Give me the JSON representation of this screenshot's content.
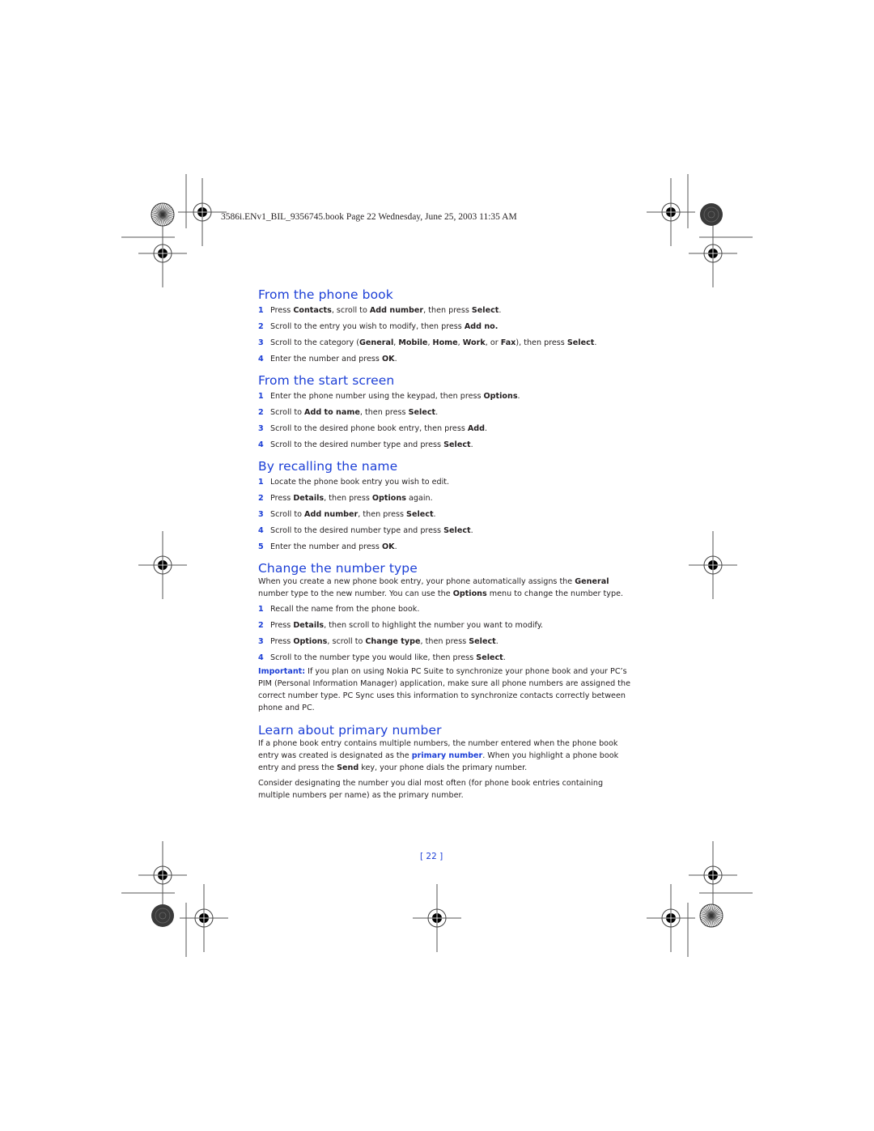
{
  "header": {
    "file_line": "3586i.ENv1_BIL_9356745.book  Page 22  Wednesday, June 25, 2003  11:35 AM"
  },
  "colors": {
    "accent": "#1c3fd6",
    "text": "#231f20"
  },
  "sections": [
    {
      "title": "From the phone book",
      "steps": [
        {
          "n": "1",
          "parts": [
            [
              "Press ",
              false
            ],
            [
              "Contacts",
              true
            ],
            [
              ", scroll to ",
              false
            ],
            [
              "Add number",
              true
            ],
            [
              ", then press ",
              false
            ],
            [
              "Select",
              true
            ],
            [
              ".",
              false
            ]
          ]
        },
        {
          "n": "2",
          "parts": [
            [
              "Scroll to the entry you wish to modify, then press ",
              false
            ],
            [
              "Add no.",
              true
            ]
          ]
        },
        {
          "n": "3",
          "parts": [
            [
              "Scroll to the category (",
              false
            ],
            [
              "General",
              true
            ],
            [
              ", ",
              false
            ],
            [
              "Mobile",
              true
            ],
            [
              ", ",
              false
            ],
            [
              "Home",
              true
            ],
            [
              ", ",
              false
            ],
            [
              "Work",
              true
            ],
            [
              ", or ",
              false
            ],
            [
              "Fax",
              true
            ],
            [
              "), then press ",
              false
            ],
            [
              "Select",
              true
            ],
            [
              ".",
              false
            ]
          ]
        },
        {
          "n": "4",
          "parts": [
            [
              "Enter the number and press ",
              false
            ],
            [
              "OK",
              true
            ],
            [
              ".",
              false
            ]
          ]
        }
      ]
    },
    {
      "title": "From the start screen",
      "steps": [
        {
          "n": "1",
          "parts": [
            [
              "Enter the phone number using the keypad, then press ",
              false
            ],
            [
              "Options",
              true
            ],
            [
              ".",
              false
            ]
          ]
        },
        {
          "n": "2",
          "parts": [
            [
              "Scroll to ",
              false
            ],
            [
              "Add to name",
              true
            ],
            [
              ", then press ",
              false
            ],
            [
              "Select",
              true
            ],
            [
              ".",
              false
            ]
          ]
        },
        {
          "n": "3",
          "parts": [
            [
              "Scroll to the desired phone book entry, then press ",
              false
            ],
            [
              "Add",
              true
            ],
            [
              ".",
              false
            ]
          ]
        },
        {
          "n": "4",
          "parts": [
            [
              "Scroll to the desired number type and press ",
              false
            ],
            [
              "Select",
              true
            ],
            [
              ".",
              false
            ]
          ]
        }
      ]
    },
    {
      "title": "By recalling the name",
      "steps": [
        {
          "n": "1",
          "parts": [
            [
              "Locate the phone book entry you wish to edit.",
              false
            ]
          ]
        },
        {
          "n": "2",
          "parts": [
            [
              "Press ",
              false
            ],
            [
              "Details",
              true
            ],
            [
              ", then press ",
              false
            ],
            [
              "Options",
              true
            ],
            [
              " again.",
              false
            ]
          ]
        },
        {
          "n": "3",
          "parts": [
            [
              "Scroll to ",
              false
            ],
            [
              "Add number",
              true
            ],
            [
              ", then press ",
              false
            ],
            [
              "Select",
              true
            ],
            [
              ".",
              false
            ]
          ]
        },
        {
          "n": "4",
          "parts": [
            [
              "Scroll to the desired number type and press ",
              false
            ],
            [
              "Select",
              true
            ],
            [
              ".",
              false
            ]
          ]
        },
        {
          "n": "5",
          "parts": [
            [
              "Enter the number and press ",
              false
            ],
            [
              "OK",
              true
            ],
            [
              ".",
              false
            ]
          ]
        }
      ]
    },
    {
      "title": "Change the number type",
      "intro": [
        [
          "When you create a new phone book entry, your phone automatically assigns the ",
          false
        ],
        [
          "General",
          true
        ],
        [
          " number type to the new number. You can use the ",
          false
        ],
        [
          "Options",
          true
        ],
        [
          " menu to change the number type.",
          false
        ]
      ],
      "steps": [
        {
          "n": "1",
          "parts": [
            [
              "Recall the name from the phone book.",
              false
            ]
          ]
        },
        {
          "n": "2",
          "parts": [
            [
              "Press ",
              false
            ],
            [
              "Details",
              true
            ],
            [
              ", then scroll to highlight the number you want to modify.",
              false
            ]
          ]
        },
        {
          "n": "3",
          "parts": [
            [
              "Press ",
              false
            ],
            [
              "Options",
              true
            ],
            [
              ", scroll to ",
              false
            ],
            [
              "Change type",
              true
            ],
            [
              ", then press ",
              false
            ],
            [
              "Select",
              true
            ],
            [
              ".",
              false
            ]
          ]
        },
        {
          "n": "4",
          "parts": [
            [
              "Scroll to the number type you would like, then press ",
              false
            ],
            [
              "Select",
              true
            ],
            [
              ".",
              false
            ]
          ]
        }
      ],
      "note": {
        "label": "Important:",
        "text": " If you plan on using Nokia PC Suite to synchronize your phone book and your PC’s PIM (Personal Information Manager) application, make sure all phone numbers are assigned the correct number type. PC Sync uses this information to synchronize contacts correctly between phone and PC."
      }
    },
    {
      "title": "Learn about primary number",
      "paragraphs": [
        [
          [
            "If a phone book entry contains multiple numbers, the number entered when the phone book entry was created is designated as the ",
            false
          ],
          [
            "primary number",
            "hl"
          ],
          [
            ". When you highlight a phone book entry and press the ",
            false
          ],
          [
            "Send",
            true
          ],
          [
            " key, your phone dials the primary number.",
            false
          ]
        ],
        [
          [
            "Consider designating the number you dial most often (for phone book entries containing multiple numbers per name) as the primary number.",
            false
          ]
        ]
      ]
    }
  ],
  "footer": {
    "page_number": "[ 22 ]"
  }
}
